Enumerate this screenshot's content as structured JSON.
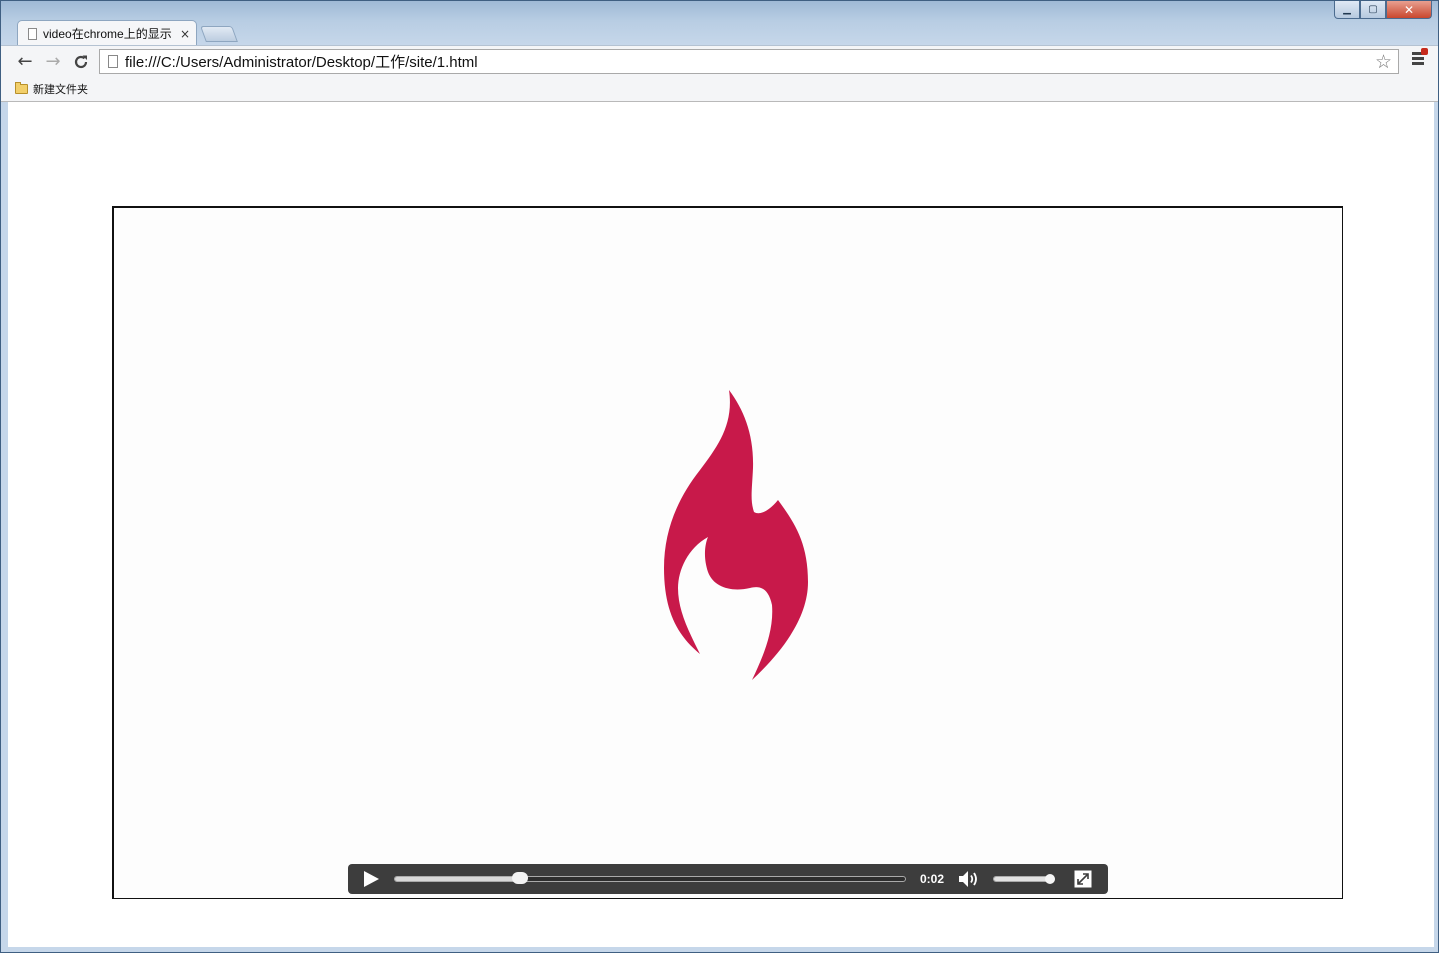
{
  "window": {
    "tab_title": "video在chrome上的显示",
    "tab_close": "×",
    "controls": {
      "minimize": "▁",
      "maximize": "▢",
      "close": "✕"
    }
  },
  "toolbar": {
    "back_icon": "←",
    "forward_icon": "→",
    "reload_icon": "C",
    "url": "file:///C:/Users/Administrator/Desktop/工作/site/1.html",
    "star_icon": "☆"
  },
  "bookmarks": {
    "items": [
      {
        "label": "新建文件夹",
        "icon": "folder-icon"
      }
    ]
  },
  "video": {
    "poster_logo": "flame-icon",
    "logo_color": "#c8194a",
    "controls": {
      "time": "0:02",
      "progress_fraction": 0.245,
      "volume_fraction": 1.0,
      "bar_color": "#3d3d3d"
    }
  }
}
